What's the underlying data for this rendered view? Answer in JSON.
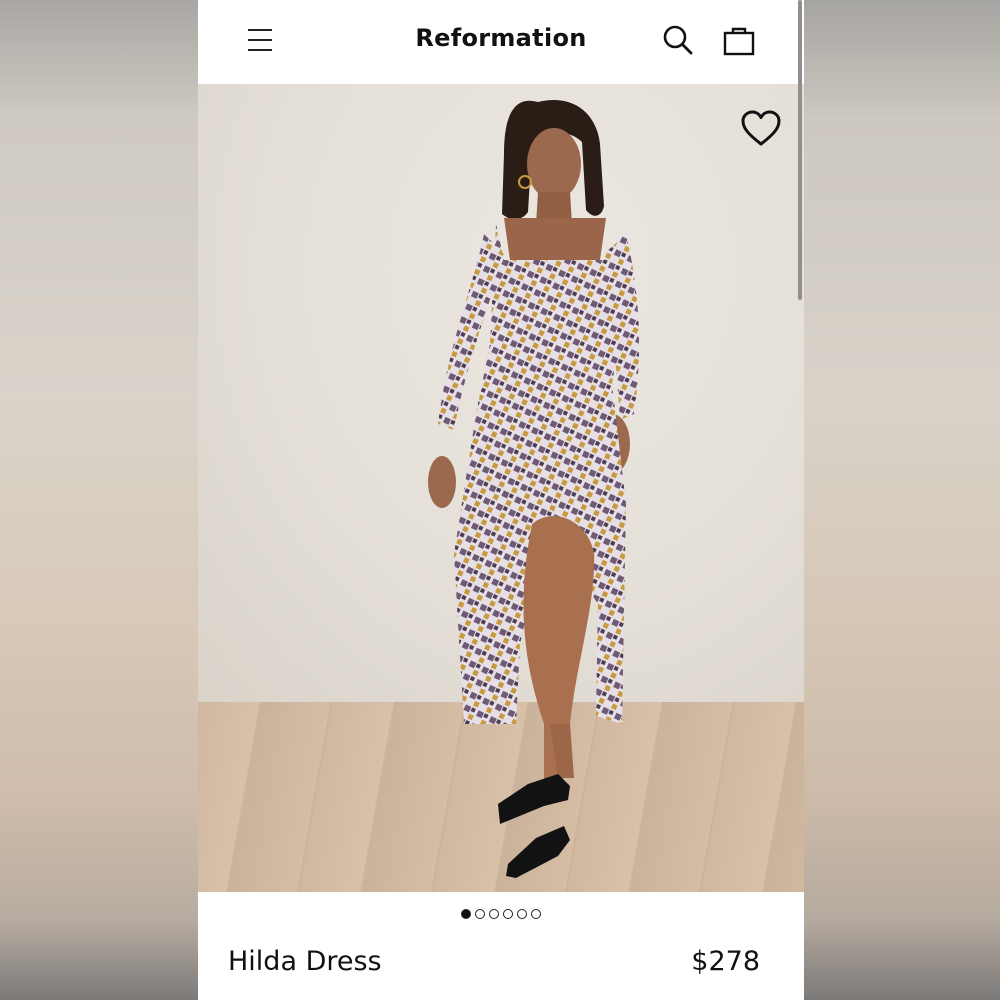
{
  "header": {
    "brand": "Reformation"
  },
  "icons": {
    "menu": "hamburger-menu-icon",
    "search": "search-icon",
    "bag": "shopping-bag-icon",
    "favorite": "heart-icon"
  },
  "gallery": {
    "image_alt": "Model wearing Hilda Dress",
    "current_slide": 1,
    "total_slides": 6
  },
  "product": {
    "name": "Hilda Dress",
    "price": "$278"
  },
  "colors": {
    "text": "#111111",
    "background": "#ffffff",
    "dress_purple": "#6e5a74",
    "dress_mustard": "#c79a3e"
  }
}
